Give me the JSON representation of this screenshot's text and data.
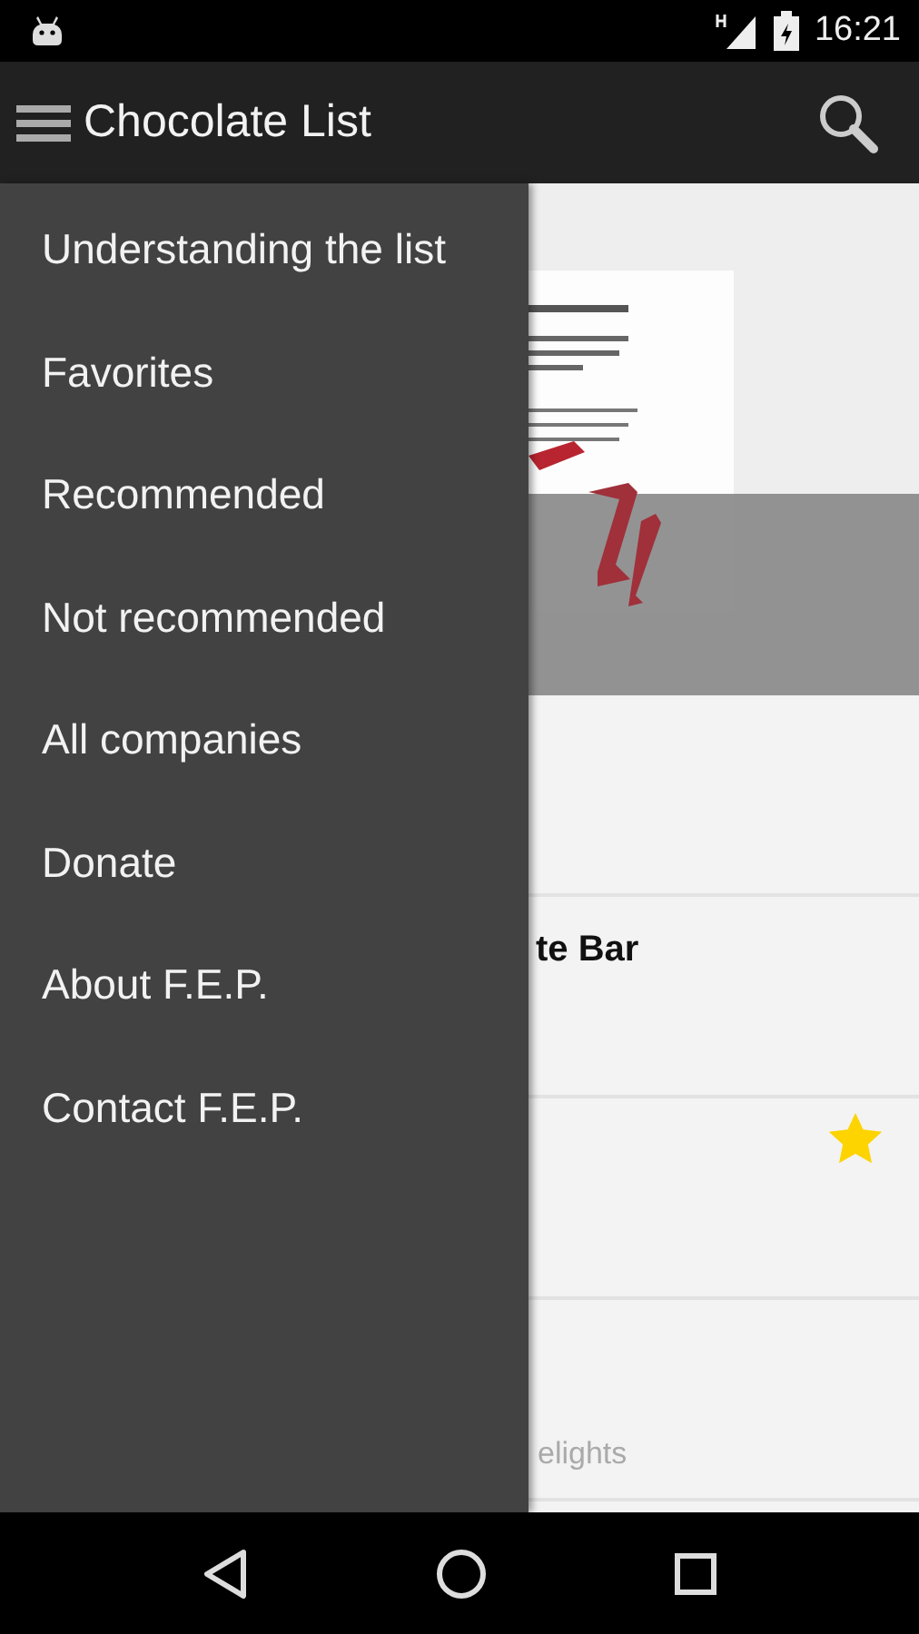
{
  "status_bar": {
    "time": "16:21"
  },
  "app_bar": {
    "title": "Chocolate List"
  },
  "drawer": {
    "items": [
      {
        "label": "Understanding the list"
      },
      {
        "label": "Favorites"
      },
      {
        "label": "Recommended"
      },
      {
        "label": "Not recommended"
      },
      {
        "label": "All companies"
      },
      {
        "label": "Donate"
      },
      {
        "label": "About F.E.P."
      },
      {
        "label": "Contact F.E.P."
      }
    ]
  },
  "list": {
    "rows": [
      {
        "favorite": false
      },
      {
        "title": "te Bar",
        "favorite": false
      },
      {
        "favorite": true
      },
      {
        "subtitle": "elights",
        "favorite": false
      }
    ]
  }
}
